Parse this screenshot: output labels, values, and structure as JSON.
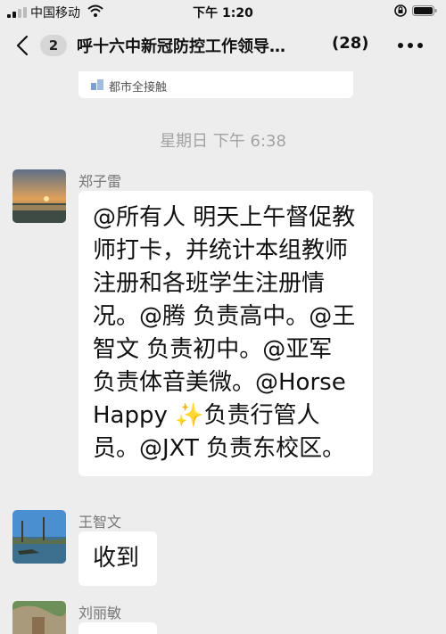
{
  "status_bar": {
    "carrier": "中国移动",
    "time": "下午 1:20"
  },
  "header": {
    "back_count": "2",
    "title": "呼十六中新冠防控工作领导…",
    "member_count": "(28)"
  },
  "link_card": {
    "source": "都市全接触"
  },
  "timestamp": "星期日 下午 6:38",
  "messages": [
    {
      "sender": "郑子雷",
      "text": "@所有人 明天上午督促教师打卡，并统计本组教师注册和各班学生注册情况。@腾 负责高中。@王智文 负责初中。@亚军 负责体音美微。@Horse Happy ✨负责行管人员。@JXT 负责东校区。"
    },
    {
      "sender": "王智文",
      "text": "收到"
    },
    {
      "sender": "刘丽敏",
      "text": ""
    }
  ]
}
